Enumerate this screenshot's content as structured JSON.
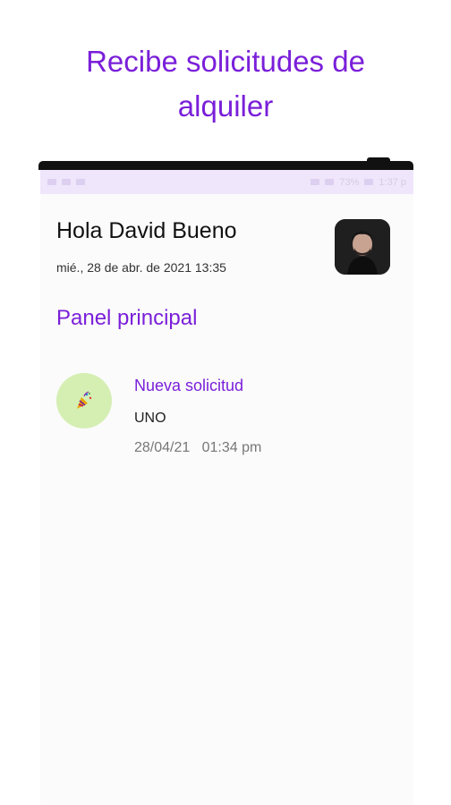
{
  "promo": {
    "line1": "Recibe solicitudes de",
    "line2": "alquiler"
  },
  "status_bar": {
    "battery": "73%",
    "time": "1:37 p"
  },
  "header": {
    "greeting": "Hola David Bueno",
    "datetime": "mié., 28 de abr. de 2021 13:35",
    "avatar_icon": "user-photo"
  },
  "dashboard": {
    "title": "Panel principal"
  },
  "notifications": [
    {
      "icon": "party-popper-icon",
      "title": "Nueva solicitud",
      "body": "UNO",
      "timestamp": "28/04/21   01:34 pm"
    }
  ],
  "colors": {
    "accent": "#7a1fd9",
    "icon_bg": "#d5efb3",
    "status_bar_bg": "#efe6fb"
  }
}
